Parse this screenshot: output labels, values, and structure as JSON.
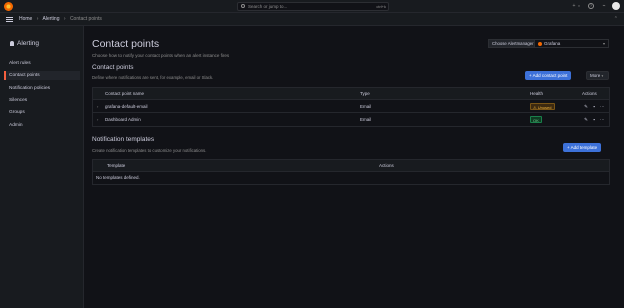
{
  "topbar": {
    "search_placeholder": "Search or jump to...",
    "search_shortcut": "ctrl+k",
    "plus_label": "+",
    "icons": [
      "help-icon",
      "news-icon"
    ]
  },
  "breadcrumbs": {
    "home": "Home",
    "sep": "›",
    "alerting": "Alerting",
    "current": "Contact points"
  },
  "sidebar": {
    "title": "Alerting",
    "items": [
      {
        "label": "Alert rules",
        "active": false
      },
      {
        "label": "Contact points",
        "active": true
      },
      {
        "label": "Notification policies",
        "active": false
      },
      {
        "label": "Silences",
        "active": false
      },
      {
        "label": "Groups",
        "active": false
      },
      {
        "label": "Admin",
        "active": false
      }
    ]
  },
  "page": {
    "title": "Contact points",
    "subtitle": "Choose how to notify your contact points when an alert instance fires",
    "alertmanager_label": "Choose Alertmanager",
    "alertmanager_value": "Grafana"
  },
  "contact_points": {
    "title": "Contact points",
    "subtitle": "Define where notifications are sent, for example, email or Slack.",
    "add_button": "+ Add contact point",
    "more_button": "More",
    "columns": [
      "Contact point name",
      "Type",
      "Health",
      "Actions"
    ],
    "rows": [
      {
        "name": "grafana-default-email",
        "type": "Email",
        "health": "Unused"
      },
      {
        "name": "Dashboard Admin",
        "type": "Email",
        "health": "OK"
      }
    ]
  },
  "templates": {
    "title": "Notification templates",
    "subtitle": "Create notification templates to customize your notifications.",
    "add_button": "+ Add template",
    "columns": [
      "Template",
      "Actions"
    ],
    "empty": "No templates defined."
  },
  "colors": {
    "accent": "#3d71d9",
    "active_marker": "#f55f3e",
    "unused": "#f5b73d",
    "ok": "#6ccf8e"
  }
}
